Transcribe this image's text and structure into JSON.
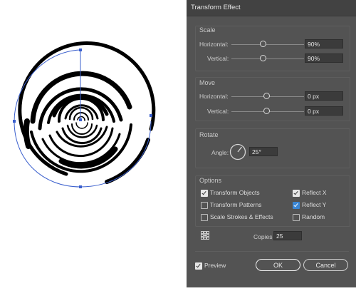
{
  "dialog": {
    "title": "Transform Effect",
    "scale": {
      "title": "Scale",
      "horizontal_label": "Horizontal:",
      "horizontal_value": "90%",
      "vertical_label": "Vertical:",
      "vertical_value": "90%"
    },
    "move": {
      "title": "Move",
      "horizontal_label": "Horizontal:",
      "horizontal_value": "0 px",
      "vertical_label": "Vertical:",
      "vertical_value": "0 px"
    },
    "rotate": {
      "title": "Rotate",
      "angle_label": "Angle:",
      "angle_value": "25°"
    },
    "options": {
      "title": "Options",
      "transform_objects": "Transform Objects",
      "transform_patterns": "Transform Patterns",
      "scale_strokes": "Scale Strokes & Effects",
      "reflect_x": "Reflect X",
      "reflect_y": "Reflect Y",
      "random": "Random"
    },
    "copies_label": "Copies",
    "copies_value": "25",
    "preview_label": "Preview",
    "ok_label": "OK",
    "cancel_label": "Cancel"
  },
  "colors": {
    "dialog_bg": "#535353",
    "selection_blue": "#3a5fcd",
    "checkbox_blue": "#3a86d4"
  }
}
